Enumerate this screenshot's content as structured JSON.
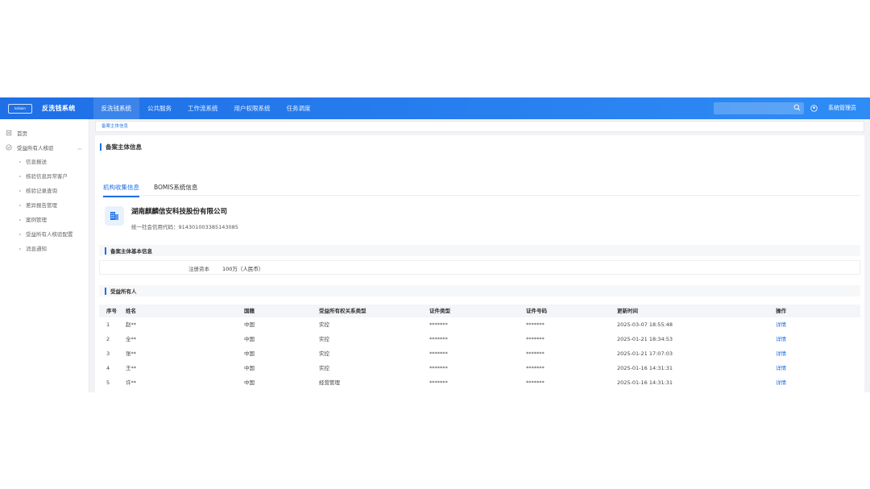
{
  "header": {
    "logo_text": "lokiwin",
    "system_title": "反洗钱系统",
    "nav": [
      {
        "label": "反洗钱系统"
      },
      {
        "label": "公共服务"
      },
      {
        "label": "工作流系统"
      },
      {
        "label": "用户权限系统"
      },
      {
        "label": "任务调度"
      }
    ],
    "search_placeholder": "",
    "user_name": "系统管理员"
  },
  "sidebar": {
    "home": "首页",
    "group": "受益所有人核验",
    "items": [
      {
        "label": "信息报送"
      },
      {
        "label": "核验信息异常客户"
      },
      {
        "label": "核验记录查询"
      },
      {
        "label": "差异报告管理"
      },
      {
        "label": "案例管理"
      },
      {
        "label": "受益所有人核验配置"
      },
      {
        "label": "消息通知"
      }
    ]
  },
  "breadcrumb": "备案主体信息",
  "main": {
    "title": "备案主体信息",
    "tabs": [
      {
        "label": "机构收集信息"
      },
      {
        "label": "BOMIS系统信息"
      }
    ],
    "company_name": "湖南麒麟信安科技股份有限公司",
    "credit_code": "统一社会信用代码：91430100338514308​5",
    "basic_section_title": "备案主体基本信息",
    "capital_label": "注册资本",
    "capital_value": "100万（人民币）",
    "owner_section_title": "受益所有人"
  },
  "table": {
    "columns": [
      "序号",
      "姓名",
      "国籍",
      "受益所有权关系类型",
      "证件类型",
      "证件号码",
      "更新时间",
      "操作"
    ],
    "rows": [
      {
        "no": "1",
        "name": "赵**",
        "nation": "中国",
        "type": "实控",
        "id_type": "*******",
        "id_no": "*******",
        "time": "2025-03-07 18:55:48",
        "op": "详情"
      },
      {
        "no": "2",
        "name": "全**",
        "nation": "中国",
        "type": "实控",
        "id_type": "*******",
        "id_no": "*******",
        "time": "2025-01-21 18:34:53",
        "op": "详情"
      },
      {
        "no": "3",
        "name": "张**",
        "nation": "中国",
        "type": "实控",
        "id_type": "*******",
        "id_no": "*******",
        "time": "2025-01-21 17:07:03",
        "op": "详情"
      },
      {
        "no": "4",
        "name": "王**",
        "nation": "中国",
        "type": "实控",
        "id_type": "*******",
        "id_no": "*******",
        "time": "2025-01-16 14:31:31",
        "op": "详情"
      },
      {
        "no": "5",
        "name": "许**",
        "nation": "中国",
        "type": "经营管理",
        "id_type": "*******",
        "id_no": "*******",
        "time": "2025-01-16 14:31:31",
        "op": "详情"
      }
    ]
  },
  "colors": {
    "primary": "#1f6fe6",
    "link": "#1f6fe6",
    "page_bg": "#f2f3f6"
  }
}
